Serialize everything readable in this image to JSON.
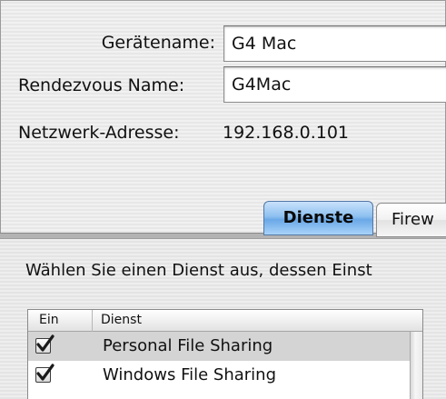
{
  "device": {
    "name_label": "Gerätename:",
    "name_value": "G4 Mac",
    "rendezvous_label": "Rendezvous Name:",
    "rendezvous_value": "G4Mac",
    "address_label": "Netzwerk-Adresse:",
    "address_value": "192.168.0.101"
  },
  "tabs": [
    {
      "label": "Dienste",
      "selected": true
    },
    {
      "label": "Firew",
      "selected": false
    }
  ],
  "services": {
    "instruction": "Wählen Sie einen Dienst aus, dessen Einst",
    "columns": {
      "on": "Ein",
      "service": "Dienst"
    },
    "rows": [
      {
        "checked": true,
        "label": "Personal File Sharing",
        "selected": true
      },
      {
        "checked": true,
        "label": "Windows File Sharing",
        "selected": false
      }
    ]
  },
  "colors": {
    "tab_active": "#8dc0f0",
    "row_selected": "#d4d4d4",
    "check_mark": "#1a1a1a"
  },
  "icons": {
    "checkbox": "checkmark-icon"
  }
}
